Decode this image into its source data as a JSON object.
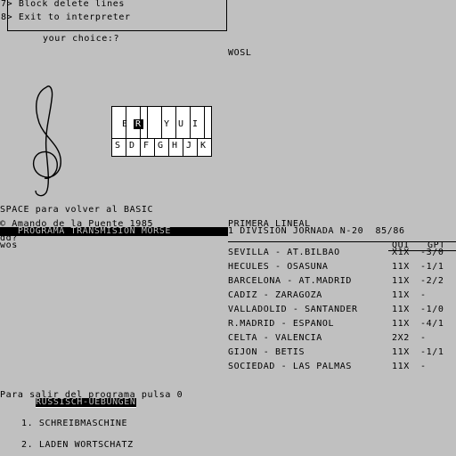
{
  "menu": {
    "item7": "7> Block delete lines",
    "item8": "8> Exit to interpreter",
    "prompt": "your choice:?"
  },
  "wosl": "WOSL",
  "piano": {
    "upper": [
      "E",
      "R",
      "",
      "Y",
      "U",
      "I",
      ""
    ],
    "lower": [
      "S",
      "D",
      "F",
      "G",
      "H",
      "J",
      "K"
    ],
    "highlight": "R"
  },
  "space_msg": "SPACE para volver al BASIC",
  "copyright": "© Amando de la Puente 1985",
  "morse_banner": "   PROGRAMA TRANSMISION MORSE   ",
  "dd": "dd?",
  "wos": "wos",
  "quiniela": {
    "title": "PRIMERA LINEAL",
    "subtitle": "1 DIVISION JORNADA N-20  85/86",
    "col_qui": "QUI",
    "col_gpt": "GPT",
    "rows": [
      {
        "match": "SEVILLA - AT.BILBAO",
        "qui": "X1X",
        "gpt": "-3/0"
      },
      {
        "match": "HECULES - OSASUNA",
        "qui": "11X",
        "gpt": "-1/1"
      },
      {
        "match": "BARCELONA - AT.MADRID",
        "qui": "11X",
        "gpt": "-2/2"
      },
      {
        "match": "CADIZ - ZARAGOZA",
        "qui": "11X",
        "gpt": "-"
      },
      {
        "match": "VALLADOLID - SANTANDER",
        "qui": "11X",
        "gpt": "-1/0"
      },
      {
        "match": "R.MADRID - ESPANOL",
        "qui": "11X",
        "gpt": "-4/1"
      },
      {
        "match": "CELTA - VALENCIA",
        "qui": "2X2",
        "gpt": "-"
      },
      {
        "match": "GIJON - BETIS",
        "qui": "11X",
        "gpt": "-1/1"
      },
      {
        "match": "SOCIEDAD - LAS PALMAS",
        "qui": "11X",
        "gpt": "-"
      }
    ]
  },
  "exit_msg": "Para salir del programa pulsa 0",
  "russisch": {
    "title": "RUSSISCH-UEBUNGEN",
    "opt1": "1. SCHREIBMASCHINE",
    "opt2": "2. LADEN WORTSCHATZ"
  },
  "icons": {
    "clef": "treble-clef-icon"
  }
}
